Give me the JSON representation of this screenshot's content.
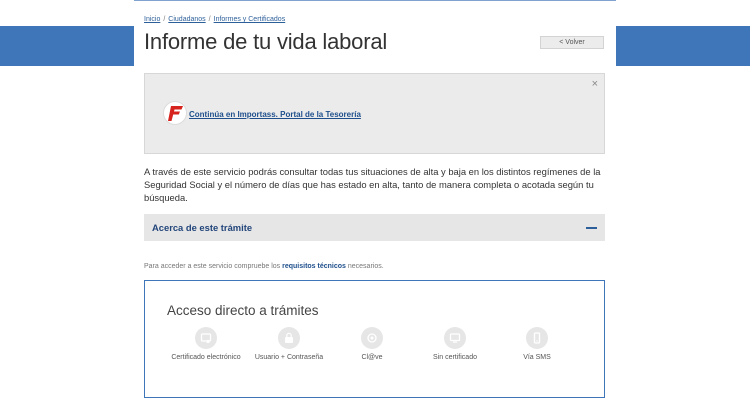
{
  "breadcrumb": {
    "items": [
      "Inicio",
      "Ciudadanos",
      "Informes y Certificados"
    ],
    "separator": "/"
  },
  "page": {
    "title": "Informe de tu vida laboral",
    "back_label": "< Volver"
  },
  "alert": {
    "close_glyph": "×",
    "link_text": "Continúa en Importass. Portal de la Tesorería",
    "logo_icon": "importass-logo-icon",
    "logo_color": "#d6231e"
  },
  "intro": {
    "text": "A través de este servicio podrás consultar todas tus situaciones de alta y baja en los distintos regímenes de la Seguridad Social y el número de días que has estado en alta, tanto de manera completa o acotada según tu búsqueda."
  },
  "accordion": {
    "title": "Acerca de este trámite"
  },
  "requirements": {
    "prefix": "Para acceder a este servicio compruebe los ",
    "link": "requisitos técnicos",
    "suffix": " necesarios."
  },
  "access": {
    "title": "Acceso directo a trámites",
    "options": [
      {
        "label": "Certificado electrónico",
        "icon": "certificate-icon"
      },
      {
        "label": "Usuario + Contraseña",
        "icon": "user-password-icon"
      },
      {
        "label": "Cl@ve",
        "icon": "clave-icon"
      },
      {
        "label": "Sin certificado",
        "icon": "monitor-icon"
      },
      {
        "label": "Vía SMS",
        "icon": "mobile-icon"
      }
    ]
  },
  "colors": {
    "band": "#3f75b9",
    "link": "#1e4f8c",
    "accordion_bg": "#e6e6e6"
  }
}
